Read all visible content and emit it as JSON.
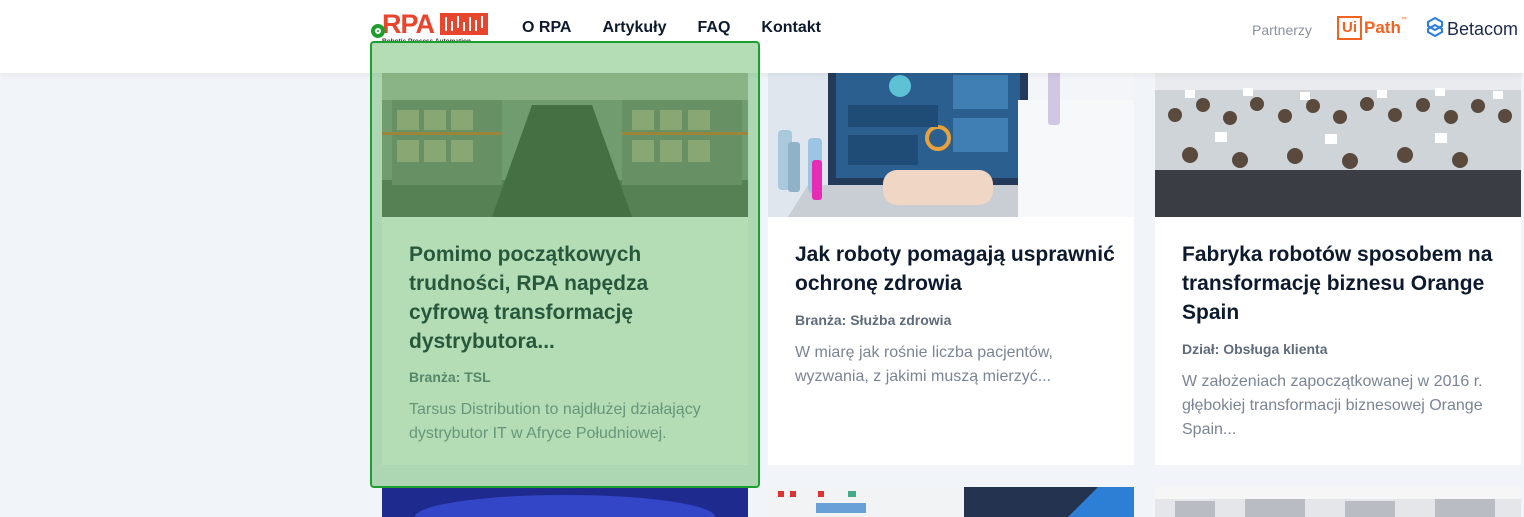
{
  "header": {
    "logo_text": "RPA",
    "logo_subtitle": "Robotic Process Automation",
    "nav": [
      "O RPA",
      "Artykuły",
      "FAQ",
      "Kontakt"
    ],
    "partners_label": "Partnerzy",
    "uipath_box": "Ui",
    "uipath_rest": "Path",
    "uipath_tm": "™",
    "betacom": "Betacom"
  },
  "cards": [
    {
      "title": "Pomimo początkowych trudności, RPA napędza cyfrową transformację dystrybutora...",
      "meta": "Branża: TSL",
      "excerpt": "Tarsus Distribution to najdłużej działający dystrybutor IT w Afryce Południowej."
    },
    {
      "title": "Jak roboty pomagają usprawnić ochronę zdrowia",
      "meta": "Branża: Służba zdrowia",
      "excerpt": "W miarę jak rośnie liczba pacjentów, wyzwania, z jakimi muszą mierzyć..."
    },
    {
      "title": "Fabryka robotów sposobem na transformację biznesu Orange Spain",
      "meta": "Dział: Obsługa klienta",
      "excerpt": "W założeniach zapoczątkowanej w 2016 r. głębokiej transformacji biznesowej Orange Spain..."
    }
  ],
  "colors": {
    "brand": "#e8452c",
    "uipath": "#f26322",
    "highlight": "#4caf50",
    "page_bg": "#f1f4f8"
  },
  "icons": [
    "target-icon",
    "betacom-logo-icon"
  ]
}
